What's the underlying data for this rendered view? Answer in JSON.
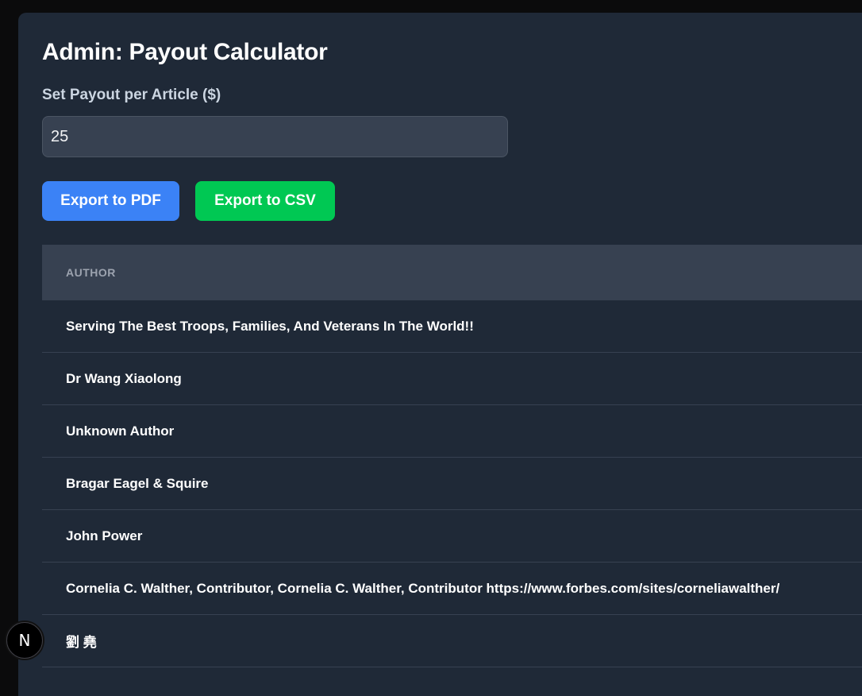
{
  "page": {
    "title": "Admin: Payout Calculator"
  },
  "payout": {
    "label": "Set Payout per Article ($)",
    "value": "25"
  },
  "actions": {
    "export_pdf": "Export to PDF",
    "export_csv": "Export to CSV"
  },
  "table": {
    "columns": [
      "AUTHOR"
    ],
    "rows": [
      "Serving The Best Troops, Families, And Veterans In The World!!",
      "Dr Wang Xiaolong",
      "Unknown Author",
      "Bragar Eagel & Squire",
      "John Power",
      "Cornelia C. Walther, Contributor, Cornelia C. Walther, Contributor https://www.forbes.com/sites/corneliawalther/",
      "劉 堯"
    ]
  },
  "dev_badge": {
    "letter": "N",
    "icon": "nextjs-logo-icon"
  },
  "colors": {
    "panel_bg": "#1f2937",
    "header_bg": "#374151",
    "pdf_button": "#3b82f6",
    "csv_button": "#00c853"
  }
}
